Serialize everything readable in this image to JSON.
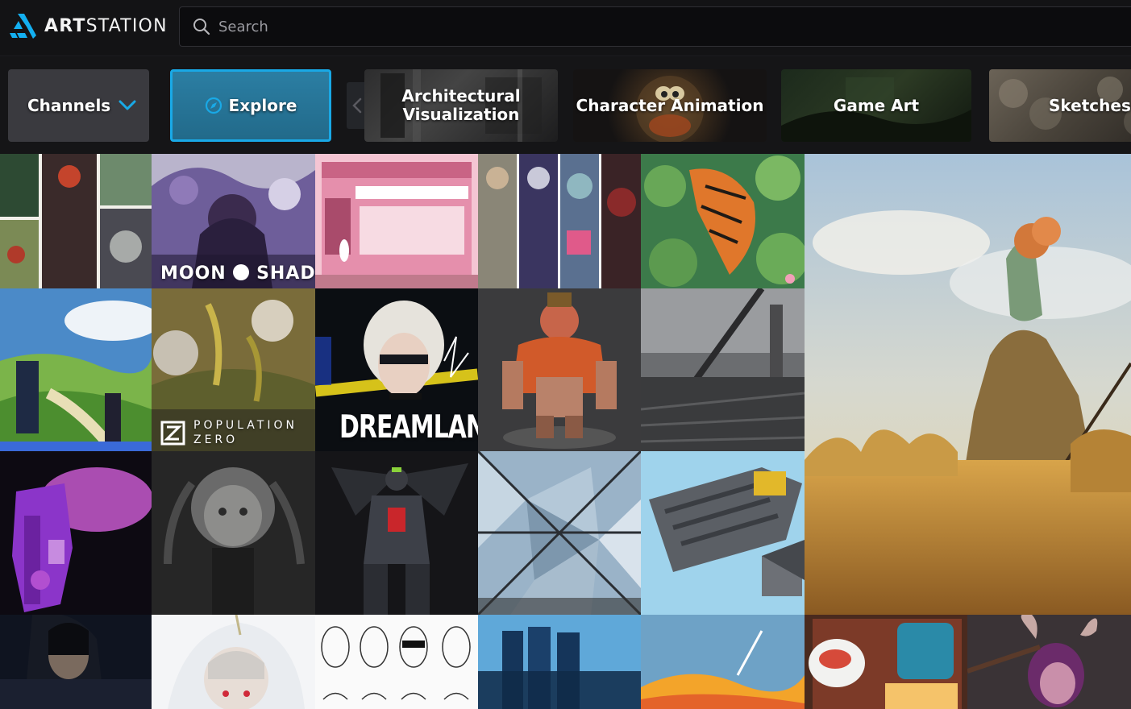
{
  "brand": {
    "logo_text_bold": "ART",
    "logo_text_light": "STATION"
  },
  "search": {
    "placeholder": "Search",
    "value": ""
  },
  "channels": {
    "dropdown_label": "Channels",
    "explore_label": "Explore",
    "items": [
      {
        "line1": "Architectural",
        "line2": "Visualization"
      },
      {
        "label": "Character Animation"
      },
      {
        "label": "Game Art"
      },
      {
        "label": "Sketches"
      }
    ]
  },
  "tile_labels": {
    "moonshades_left": "MOON",
    "moonshades_right": "SHADES",
    "population_line1": "POPULATION",
    "population_line2": "ZERO",
    "dreamland": "DREAMLAND"
  },
  "colors": {
    "accent": "#19a9e6",
    "header_bg": "#131315",
    "chip_bg": "#3a3a3f",
    "page_bg": "#111113"
  },
  "icons": [
    "artstation-logo-icon",
    "search-icon",
    "chevron-down-icon",
    "compass-icon",
    "chevron-left-icon"
  ]
}
